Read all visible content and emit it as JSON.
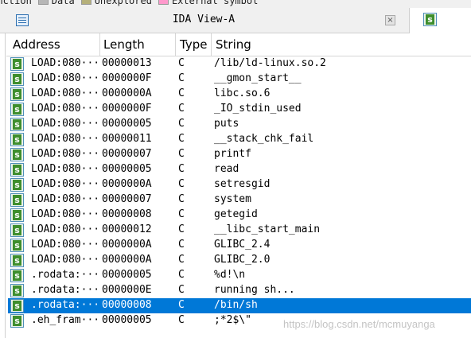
{
  "legend": {
    "items": [
      {
        "label": "Function",
        "color": "#6fa8dc"
      },
      {
        "label": "Data",
        "color": "#b7b7b7"
      },
      {
        "label": "Unexplored",
        "color": "#b5b07a"
      },
      {
        "label": "External symbol",
        "color": "#ff99cc"
      }
    ]
  },
  "tabs": {
    "active_title": "IDA View-A",
    "close_glyph": "×"
  },
  "table": {
    "headers": {
      "address": "Address",
      "length": "Length",
      "type": "Type",
      "string": "String"
    },
    "rows": [
      {
        "address": "LOAD:080···",
        "length": "00000013",
        "type": "C",
        "string": "/lib/ld-linux.so.2"
      },
      {
        "address": "LOAD:080···",
        "length": "0000000F",
        "type": "C",
        "string": "__gmon_start__"
      },
      {
        "address": "LOAD:080···",
        "length": "0000000A",
        "type": "C",
        "string": "libc.so.6"
      },
      {
        "address": "LOAD:080···",
        "length": "0000000F",
        "type": "C",
        "string": "_IO_stdin_used"
      },
      {
        "address": "LOAD:080···",
        "length": "00000005",
        "type": "C",
        "string": "puts"
      },
      {
        "address": "LOAD:080···",
        "length": "00000011",
        "type": "C",
        "string": "__stack_chk_fail"
      },
      {
        "address": "LOAD:080···",
        "length": "00000007",
        "type": "C",
        "string": "printf"
      },
      {
        "address": "LOAD:080···",
        "length": "00000005",
        "type": "C",
        "string": "read"
      },
      {
        "address": "LOAD:080···",
        "length": "0000000A",
        "type": "C",
        "string": "setresgid"
      },
      {
        "address": "LOAD:080···",
        "length": "00000007",
        "type": "C",
        "string": "system"
      },
      {
        "address": "LOAD:080···",
        "length": "00000008",
        "type": "C",
        "string": "getegid"
      },
      {
        "address": "LOAD:080···",
        "length": "00000012",
        "type": "C",
        "string": "__libc_start_main"
      },
      {
        "address": "LOAD:080···",
        "length": "0000000A",
        "type": "C",
        "string": "GLIBC_2.4"
      },
      {
        "address": "LOAD:080···",
        "length": "0000000A",
        "type": "C",
        "string": "GLIBC_2.0"
      },
      {
        "address": ".rodata:···",
        "length": "00000005",
        "type": "C",
        "string": "%d!\\n"
      },
      {
        "address": ".rodata:···",
        "length": "0000000E",
        "type": "C",
        "string": "running sh..."
      },
      {
        "address": ".rodata:···",
        "length": "00000008",
        "type": "C",
        "string": "/bin/sh",
        "selected": true
      },
      {
        "address": ".eh_fram···",
        "length": "00000005",
        "type": "C",
        "string": ";*2$\\\""
      }
    ]
  },
  "row_icon_glyph": "s",
  "watermark": "https://blog.csdn.net/mcmuyanga",
  "colors": {
    "selection": "#0078d7",
    "icon_green": "#3e8e2d"
  }
}
